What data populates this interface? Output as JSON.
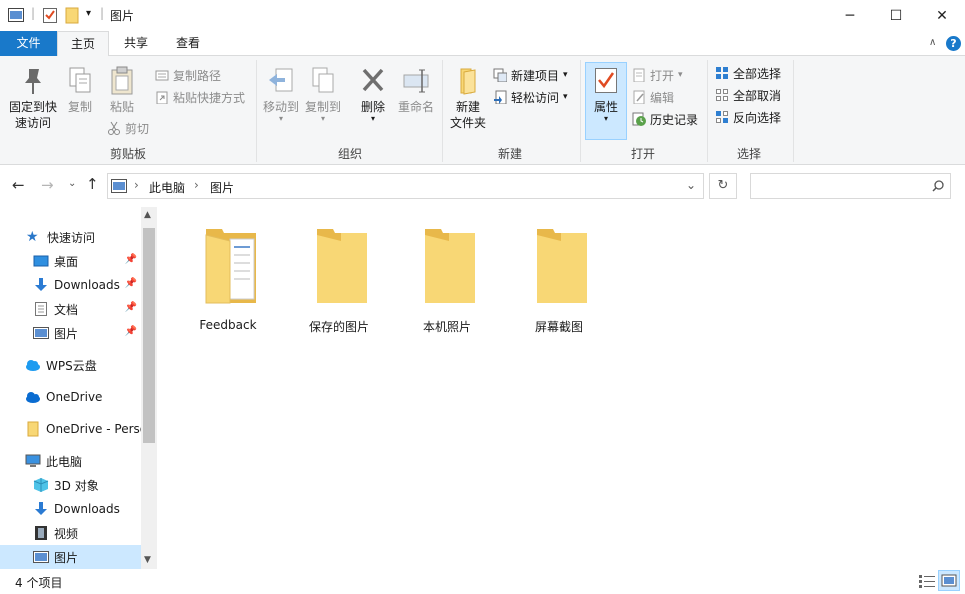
{
  "window": {
    "title": "图片",
    "minimize": "─",
    "maximize": "☐",
    "close": "✕"
  },
  "ribbon_tabs": {
    "file": "文件",
    "home": "主页",
    "share": "共享",
    "view": "查看",
    "help": "?"
  },
  "ribbon": {
    "clipboard": {
      "pin_quick_access": [
        "固定到快",
        "速访问"
      ],
      "copy": "复制",
      "paste": "粘贴",
      "copy_path": "复制路径",
      "paste_shortcut": "粘贴快捷方式",
      "cut": "剪切",
      "group_label": "剪贴板"
    },
    "organize": {
      "move_to": "移动到",
      "copy_to": "复制到",
      "delete": "删除",
      "rename": "重命名",
      "group_label": "组织"
    },
    "new": {
      "new_folder": [
        "新建",
        "文件夹"
      ],
      "new_item": "新建项目",
      "easy_access": "轻松访问",
      "group_label": "新建"
    },
    "open": {
      "properties": "属性",
      "open": "打开",
      "edit": "编辑",
      "history": "历史记录",
      "group_label": "打开"
    },
    "select": {
      "select_all": "全部选择",
      "select_none": "全部取消",
      "invert": "反向选择",
      "group_label": "选择"
    }
  },
  "address": {
    "crumbs": [
      "此电脑",
      "图片"
    ],
    "separator": "›",
    "search_placeholder": ""
  },
  "nav": {
    "quick_access": "快速访问",
    "items": [
      {
        "label": "桌面",
        "pinned": true
      },
      {
        "label": "Downloads",
        "pinned": true
      },
      {
        "label": "文档",
        "pinned": true
      },
      {
        "label": "图片",
        "pinned": true
      },
      {
        "label": "WPS云盘"
      },
      {
        "label": "OneDrive"
      },
      {
        "label": "OneDrive - Perso"
      },
      {
        "label": "此电脑"
      },
      {
        "label": "3D 对象"
      },
      {
        "label": "Downloads"
      },
      {
        "label": "视频"
      },
      {
        "label": "图片",
        "selected": true
      }
    ]
  },
  "folders": [
    {
      "label": "Feedback"
    },
    {
      "label": "保存的图片"
    },
    {
      "label": "本机照片"
    },
    {
      "label": "屏幕截图"
    }
  ],
  "status": {
    "item_count": "4 个项目"
  },
  "colors": {
    "accent": "#1979ca",
    "folder": "#f8d775",
    "folder_dark": "#e8b84a",
    "selected_nav": "#cce8ff"
  }
}
